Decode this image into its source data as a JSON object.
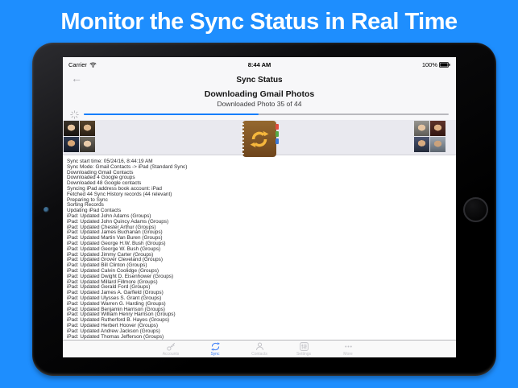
{
  "banner": {
    "title": "Monitor the Sync Status in Real Time"
  },
  "colors": {
    "background_blue": "#1E8EFE",
    "ios_tint": "#157EFB",
    "active_tab": "#3B7DF8"
  },
  "device": {
    "status_bar": {
      "carrier": "Carrier",
      "wifi_icon": "wifi-icon",
      "time": "8:44 AM",
      "battery": "100%",
      "battery_icon": "battery-full-icon"
    },
    "nav": {
      "back_icon": "←",
      "title": "Sync Status"
    },
    "download": {
      "title": "Downloading Gmail Photos",
      "subtitle": "Downloaded Photo 35 of 44",
      "progress_percent": 48,
      "spinner_icon": "activity-spinner-icon"
    },
    "photo_strip": {
      "app_icon": "contacts-sync-notebook-icon",
      "left_photos": [
        "contact-portrait",
        "contact-portrait",
        "contact-portrait",
        "contact-portrait"
      ],
      "right_photos": [
        "contact-portrait",
        "contact-portrait",
        "contact-portrait",
        "contact-portrait"
      ]
    },
    "log": {
      "lines": [
        "Sync start time: 05/24/16, 8:44:19 AM",
        "Sync Mode: Gmail Contacts -> iPad (Standard Sync)",
        "Downloading Gmail Contacts",
        "Downloaded 4 Google groups",
        "Downloaded 48 Google contacts",
        "Syncing iPad address book account: iPad",
        "Fetched 44 Sync History records (44 relevant)",
        "Preparing to Sync",
        "Sorting Records",
        "Updating iPad Contacts",
        "iPad: Updated John Adams (Groups)",
        "iPad: Updated John Quincy Adams (Groups)",
        "iPad: Updated Chester Arthur (Groups)",
        "iPad: Updated James Buchanan (Groups)",
        "iPad: Updated Martin Van Buren (Groups)",
        "iPad: Updated George H.W. Bush (Groups)",
        "iPad: Updated George W. Bush (Groups)",
        "iPad: Updated Jimmy Carter (Groups)",
        "iPad: Updated Grover Cleveland (Groups)",
        "iPad: Updated Bill Clinton (Groups)",
        "iPad: Updated Calvin Coolidge (Groups)",
        "iPad: Updated Dwight D. Eisenhower (Groups)",
        "iPad: Updated Millard Fillmore (Groups)",
        "iPad: Updated Gerald Ford (Groups)",
        "iPad: Updated James A. Garfield (Groups)",
        "iPad: Updated Ulysses S. Grant (Groups)",
        "iPad: Updated Warren G. Harding (Groups)",
        "iPad: Updated Benjamin Harrison (Groups)",
        "iPad: Updated William Henry Harrison (Groups)",
        "iPad: Updated Rutherford B. Hayes (Groups)",
        "iPad: Updated Herbert Hoover (Groups)",
        "iPad: Updated Andrew Jackson (Groups)",
        "iPad: Updated Thomas Jefferson (Groups)"
      ]
    },
    "tabbar": {
      "items": [
        {
          "label": "Accounts",
          "icon": "key-icon",
          "active": false
        },
        {
          "label": "Sync",
          "icon": "sync-arrows-icon",
          "active": true
        },
        {
          "label": "Contacts",
          "icon": "person-icon",
          "active": false
        },
        {
          "label": "Settings",
          "icon": "sliders-icon",
          "active": false
        },
        {
          "label": "More",
          "icon": "ellipsis-icon",
          "active": false
        }
      ]
    }
  }
}
